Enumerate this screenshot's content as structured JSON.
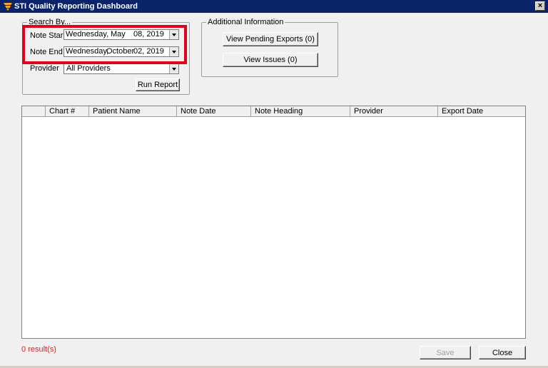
{
  "window": {
    "title": "STI Quality Reporting Dashboard",
    "close_label": "×"
  },
  "search": {
    "legend": "Search By...",
    "note_start": {
      "label": "Note Start",
      "weekday": "Wednesday,",
      "month": "May",
      "day_year": "08, 2019"
    },
    "note_end": {
      "label": "Note End",
      "weekday": "Wednesday,",
      "month": "October",
      "day_year": "02, 2019"
    },
    "provider": {
      "label": "Provider",
      "value": "All Providers"
    },
    "run_label": "Run Report"
  },
  "additional": {
    "legend": "Additional Information",
    "pending_label": "View Pending Exports (0)",
    "issues_label": "View Issues (0)"
  },
  "table": {
    "columns": [
      "",
      "Chart #",
      "Patient Name",
      "Note Date",
      "Note Heading",
      "Provider",
      "Export Date"
    ],
    "rows": []
  },
  "footer": {
    "results": "0 result(s)",
    "save_label": "Save",
    "close_label": "Close"
  },
  "colors": {
    "titlebar": "#0a246a",
    "highlight": "#e0001b",
    "results_text": "#e02020"
  }
}
